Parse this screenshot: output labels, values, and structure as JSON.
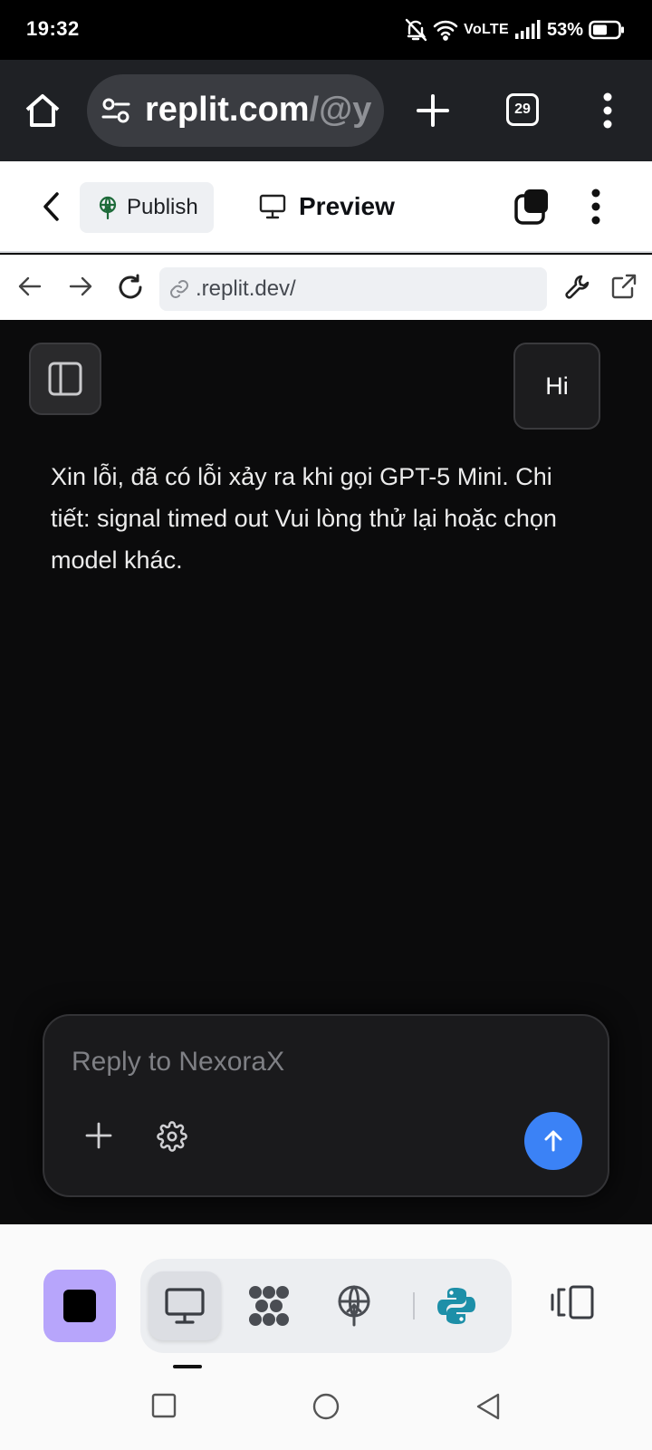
{
  "status_bar": {
    "time": "19:32",
    "network": "VoLTE",
    "battery": "53%",
    "icons": [
      "bell-off-icon",
      "wifi-icon",
      "signal-icon",
      "battery-icon"
    ]
  },
  "browser": {
    "url_host": "replit.com",
    "url_path": "/@y",
    "tab_count": "29",
    "icons": [
      "home-icon",
      "site-settings-icon",
      "new-tab-icon",
      "tab-switcher-icon",
      "more-icon"
    ]
  },
  "replit_header": {
    "publish_label": "Publish",
    "preview_label": "Preview",
    "icons": [
      "back-icon",
      "publish-icon",
      "monitor-icon",
      "tabs-icon",
      "kebab-icon"
    ]
  },
  "preview_bar": {
    "url": ".replit.dev/",
    "icons": [
      "arrow-left-icon",
      "arrow-right-icon",
      "reload-icon",
      "link-icon",
      "wrench-icon",
      "external-link-icon"
    ]
  },
  "chat": {
    "user_message": "Hi",
    "assistant_message": "Xin lỗi, đã có lỗi xảy ra khi gọi GPT-5 Mini. Chi tiết: signal timed out Vui lòng thử lại hoặc chọn model khác.",
    "input_placeholder": "Reply to NexoraX",
    "colors": {
      "background": "#0b0b0c",
      "send_button": "#3b82f6"
    }
  },
  "dock": {
    "items": [
      "stop-icon",
      "preview-monitor-icon",
      "workflows-icon",
      "deploy-icon",
      "python-icon",
      "layout-toggle-icon"
    ],
    "colors": {
      "stop_button": "#b7a5fb"
    }
  },
  "nav_bar": {
    "items": [
      "recents-square-icon",
      "home-circle-icon",
      "back-triangle-icon"
    ]
  }
}
